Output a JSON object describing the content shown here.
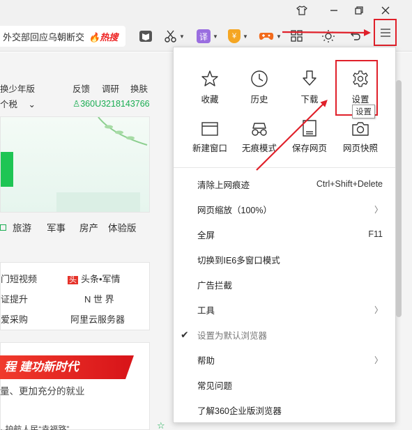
{
  "window": {
    "controls": [
      "tshirt-icon",
      "minimize-icon",
      "restore-icon",
      "close-icon"
    ]
  },
  "toolbar": {
    "address_text": "外交部回应乌朝断交",
    "hot_label": "🔥热搜",
    "translate_label": "译",
    "coin_label": "¥"
  },
  "page": {
    "nav_top": [
      "换少年版",
      "反馈",
      "调研",
      "换肤"
    ],
    "nav_second": "个税",
    "user_id": "360U3218143766",
    "categories": [
      "旅游",
      "军事",
      "房产",
      "体验版"
    ],
    "news": [
      {
        "left": "门短视频",
        "right": "头条•军情"
      },
      {
        "left": "证提升",
        "right": "N 世 界"
      },
      {
        "left": "爱采购",
        "right": "阿里云服务器"
      }
    ],
    "news_tag": "头",
    "banner_text": "程  建功新时代",
    "body_line1": "量、更加充分的就业",
    "body_line2": "· 护航人民“幸福路”",
    "bottom_badge": "医生"
  },
  "menu": {
    "grid": [
      {
        "label": "收藏",
        "icon": "star-icon"
      },
      {
        "label": "历史",
        "icon": "clock-icon"
      },
      {
        "label": "下载",
        "icon": "download-icon"
      },
      {
        "label": "设置",
        "icon": "gear-icon"
      },
      {
        "label": "新建窗口",
        "icon": "window-icon"
      },
      {
        "label": "无痕模式",
        "icon": "incognito-icon"
      },
      {
        "label": "保存网页",
        "icon": "save-page-icon"
      },
      {
        "label": "网页快照",
        "icon": "camera-icon"
      }
    ],
    "items": [
      {
        "label": "清除上网痕迹",
        "shortcut": "Ctrl+Shift+Delete"
      },
      {
        "label": "网页缩放（100%）",
        "submenu": true
      },
      {
        "label": "全屏",
        "shortcut": "F11"
      },
      {
        "label": "切换到IE6多窗口模式"
      },
      {
        "label": "广告拦截"
      },
      {
        "label": "工具",
        "submenu": true
      },
      {
        "label": "设置为默认浏览器",
        "checked": true,
        "disabled": true
      },
      {
        "label": "帮助",
        "submenu": true
      },
      {
        "label": "常见问题"
      },
      {
        "label": "了解360企业版浏览器"
      }
    ],
    "tooltip": "设置"
  },
  "colors": {
    "annotation_red": "#e0202a",
    "green": "#1aad52",
    "hot_red": "#e22222"
  }
}
